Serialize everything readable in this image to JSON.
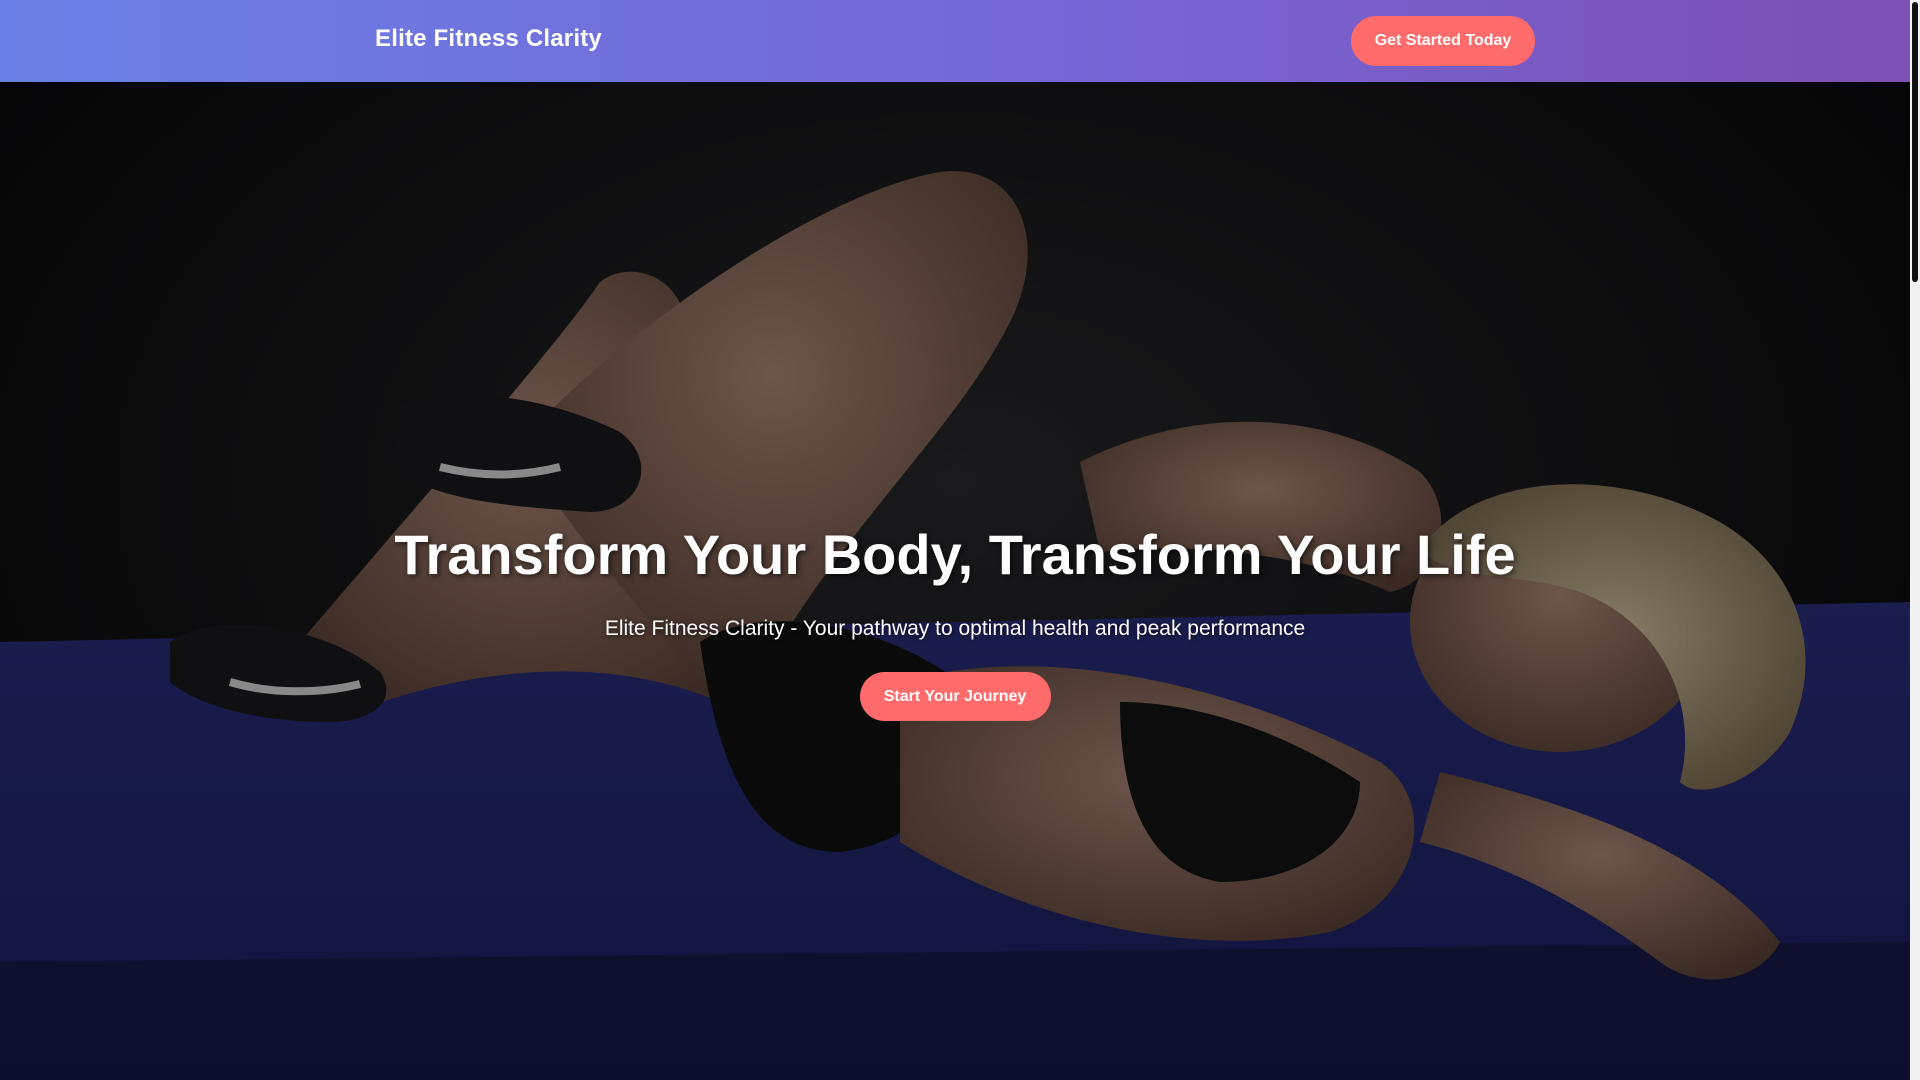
{
  "header": {
    "brand": "Elite Fitness Clarity",
    "cta_label": "Get Started Today"
  },
  "hero": {
    "title": "Transform Your Body, Transform Your Life",
    "subtitle": "Elite Fitness Clarity - Your pathway to optimal health and peak performance",
    "cta_label": "Start Your Journey",
    "image_icon": "woman-doing-crunches-on-mat-photo"
  },
  "colors": {
    "header_gradient_start": "#6a7fe5",
    "header_gradient_end": "#7c50b4",
    "accent": "#ff6b6b",
    "text": "#ffffff",
    "mat": "#2a2f8a"
  }
}
